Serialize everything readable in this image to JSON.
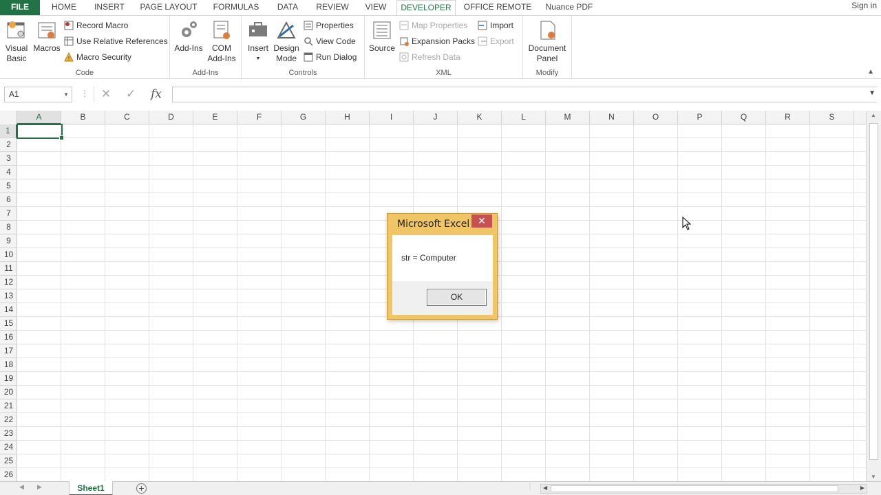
{
  "tabs": [
    "FILE",
    "HOME",
    "INSERT",
    "PAGE LAYOUT",
    "FORMULAS",
    "DATA",
    "REVIEW",
    "VIEW",
    "DEVELOPER",
    "OFFICE REMOTE",
    "Nuance PDF"
  ],
  "active_tab": "DEVELOPER",
  "sign_in": "Sign in",
  "ribbon": {
    "code": {
      "label": "Code",
      "visual_basic": [
        "Visual",
        "Basic"
      ],
      "macros": "Macros",
      "record_macro": "Record Macro",
      "use_relative": "Use Relative References",
      "macro_security": "Macro Security"
    },
    "addins": {
      "label": "Add-Ins",
      "addins": "Add-Ins",
      "com_addins": [
        "COM",
        "Add-Ins"
      ]
    },
    "controls": {
      "label": "Controls",
      "insert": "Insert",
      "design_mode": [
        "Design",
        "Mode"
      ],
      "properties": "Properties",
      "view_code": "View Code",
      "run_dialog": "Run Dialog"
    },
    "xml": {
      "label": "XML",
      "source": "Source",
      "map_properties": "Map Properties",
      "expansion_packs": "Expansion Packs",
      "refresh_data": "Refresh Data",
      "import": "Import",
      "export": "Export"
    },
    "modify": {
      "label": "Modify",
      "document_panel": [
        "Document",
        "Panel"
      ]
    }
  },
  "formula_bar": {
    "name_box": "A1",
    "formula": "",
    "fx": "fx"
  },
  "columns": [
    "A",
    "B",
    "C",
    "D",
    "E",
    "F",
    "G",
    "H",
    "I",
    "J",
    "K",
    "L",
    "M",
    "N",
    "O",
    "P",
    "Q",
    "R",
    "S"
  ],
  "rows": [
    "1",
    "2",
    "3",
    "4",
    "5",
    "6",
    "7",
    "8",
    "9",
    "10",
    "11",
    "12",
    "13",
    "14",
    "15",
    "16",
    "17",
    "18",
    "19",
    "20",
    "21",
    "22",
    "23",
    "24",
    "25",
    "26"
  ],
  "selected_cell": "A1",
  "sheet_tab": "Sheet1",
  "dialog": {
    "title": "Microsoft Excel",
    "close": "✕",
    "message": "str = Computer",
    "ok": "OK"
  },
  "colors": {
    "excel_green": "#217346",
    "dialog_frame": "#f0c566",
    "close_red": "#c75050"
  }
}
